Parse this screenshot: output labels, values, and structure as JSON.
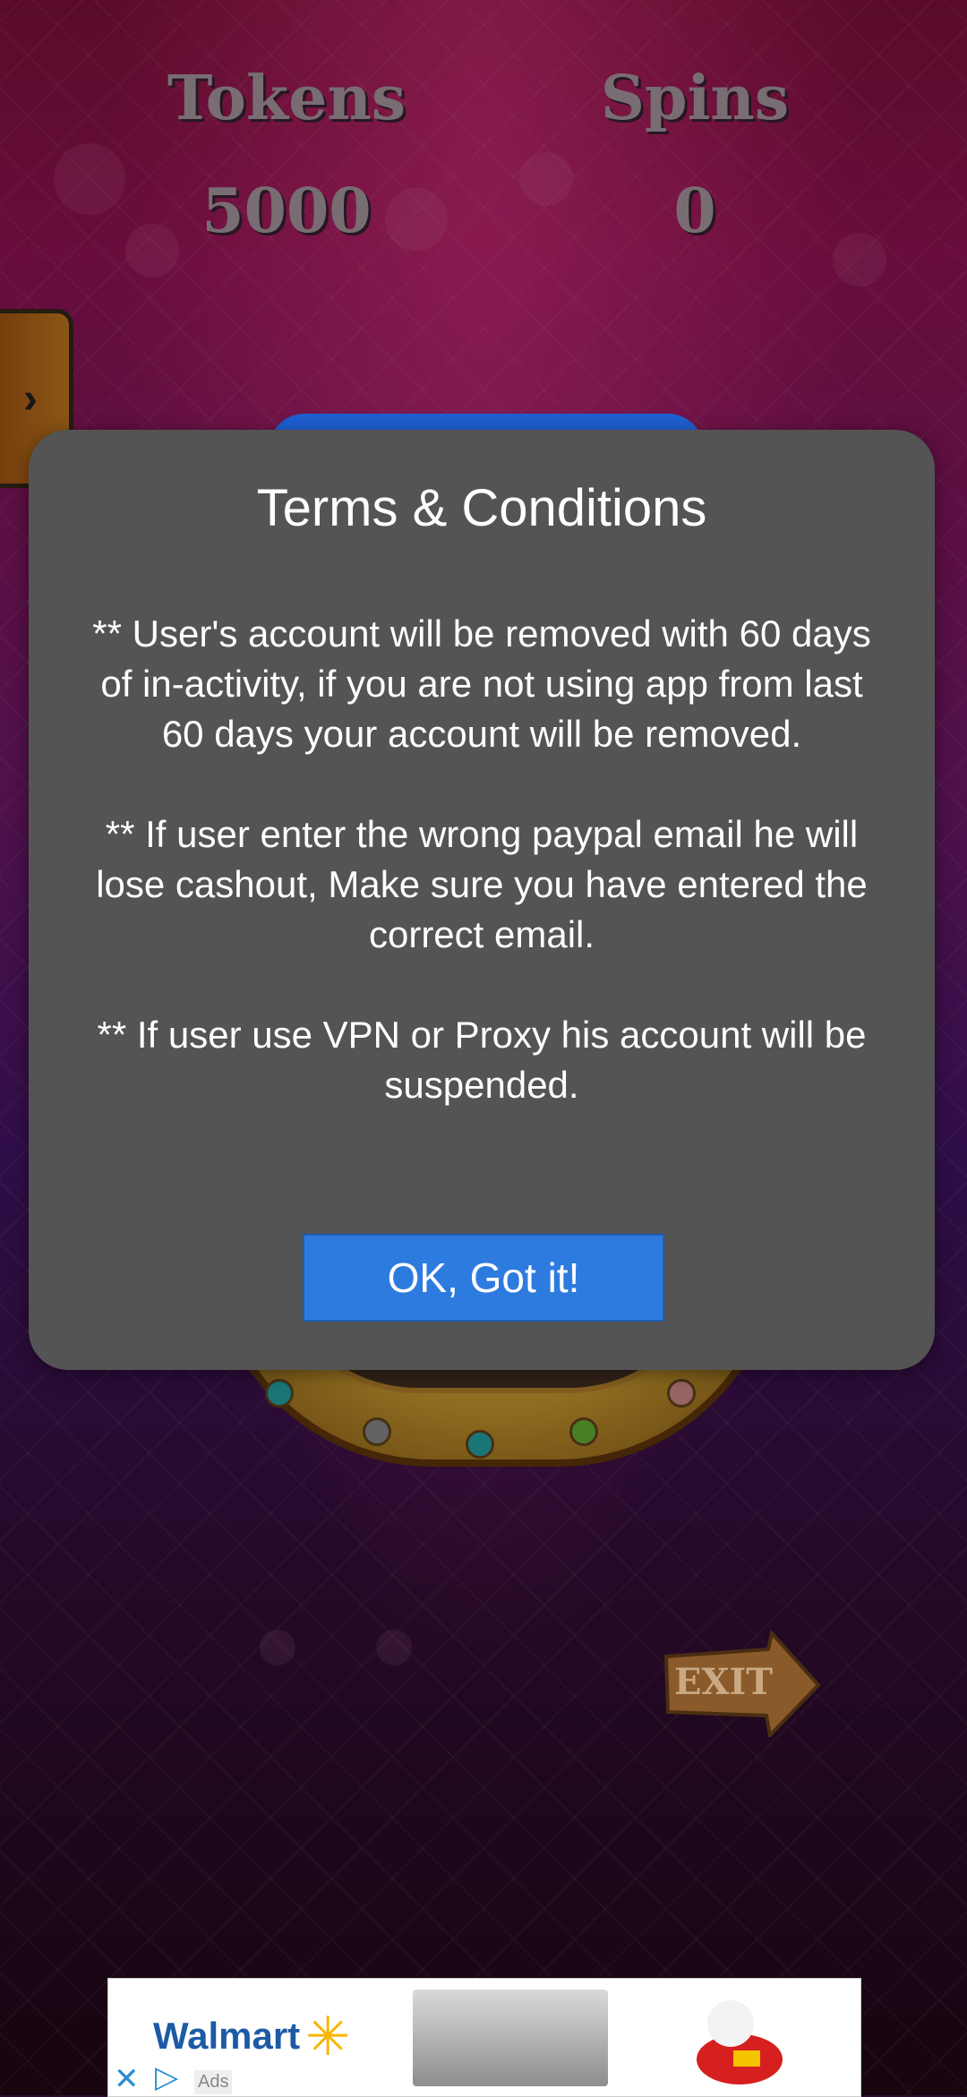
{
  "stats": {
    "tokens_label": "Tokens",
    "tokens_value": "5000",
    "spins_label": "Spins",
    "spins_value": "0"
  },
  "side_tab": {
    "icon": "chevron-right-icon",
    "glyph": "›"
  },
  "exit_sign": {
    "label": "EXIT"
  },
  "dialog": {
    "title": "Terms & Conditions",
    "terms": [
      "**  User's account will be removed with 60 days of in-activity, if you are not using app from last 60 days your account will be removed.",
      "** If user enter the wrong paypal email he will lose cashout, Make sure you have entered the correct email.",
      "** If user use VPN or Proxy his account will be suspended."
    ],
    "ok_label": "OK, Got it!"
  },
  "ad": {
    "brand": "Walmart",
    "brand_mark": "✳",
    "ads_label": "Ads",
    "close_glyph": "✕",
    "play_glyph": "▷"
  },
  "colors": {
    "dialog_bg": "#545454",
    "button_bg": "#2e7be0",
    "background_top": "#a0155c",
    "background_mid": "#4a1670"
  }
}
